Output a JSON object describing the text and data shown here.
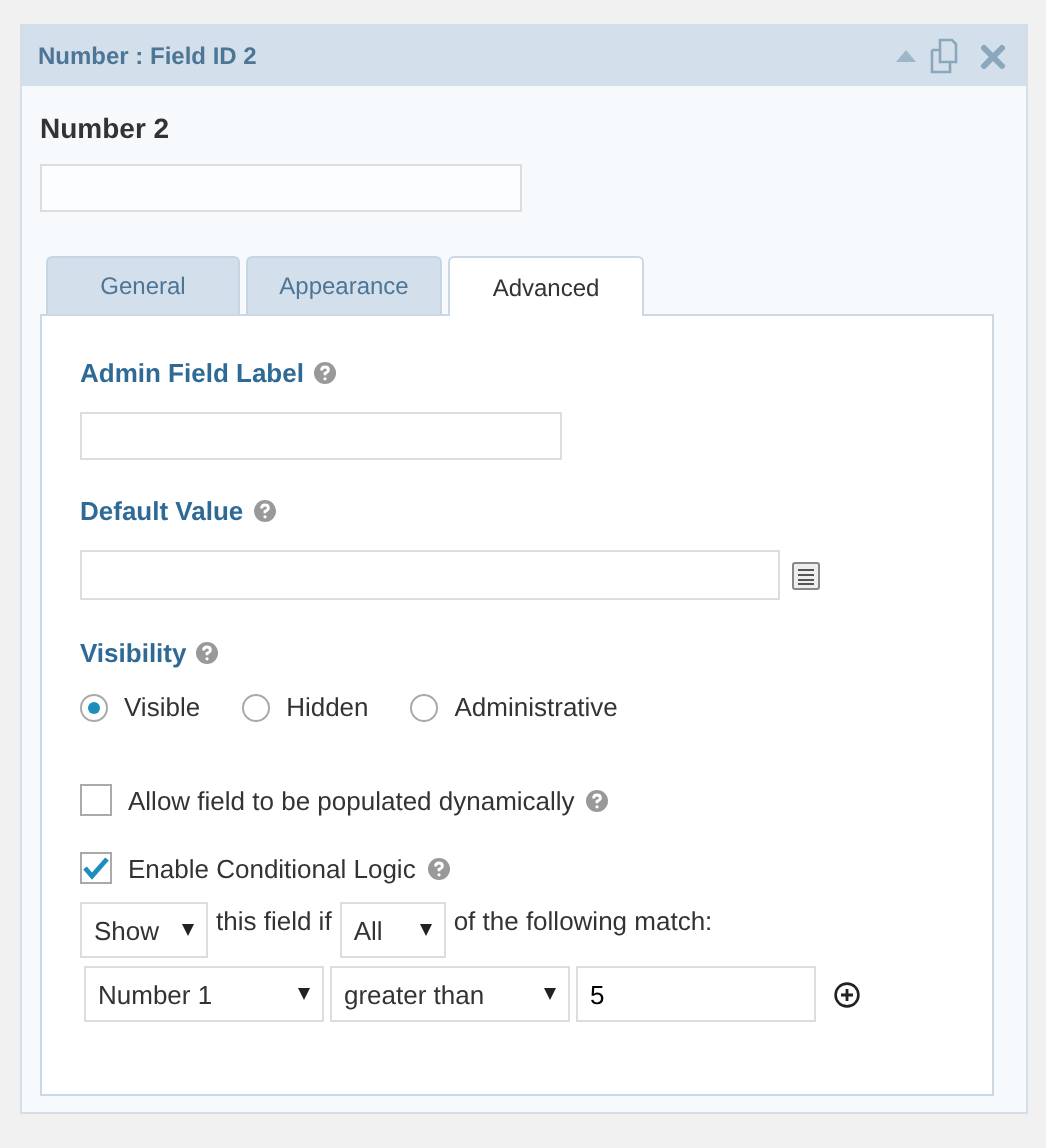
{
  "header": {
    "title": "Number : Field ID 2"
  },
  "field": {
    "label": "Number 2"
  },
  "tabs": [
    {
      "label": "General",
      "selected": false
    },
    {
      "label": "Appearance",
      "selected": false
    },
    {
      "label": "Advanced",
      "selected": true
    }
  ],
  "admin_label": {
    "label": "Admin Field Label"
  },
  "default_value": {
    "label": "Default Value"
  },
  "visibility": {
    "label": "Visibility",
    "options": [
      {
        "label": "Visible",
        "selected": true
      },
      {
        "label": "Hidden",
        "selected": false
      },
      {
        "label": "Administrative",
        "selected": false
      }
    ]
  },
  "options": [
    {
      "label": "Allow field to be populated dynamically",
      "checked": false
    },
    {
      "label": "Enable Conditional Logic",
      "checked": true
    }
  ],
  "conditional": {
    "action": "Show",
    "text_1": "this field if",
    "logic": "All",
    "text_2": "of the following match:",
    "rule": {
      "field": "Number 1",
      "operator": "greater than",
      "value": "5"
    }
  }
}
